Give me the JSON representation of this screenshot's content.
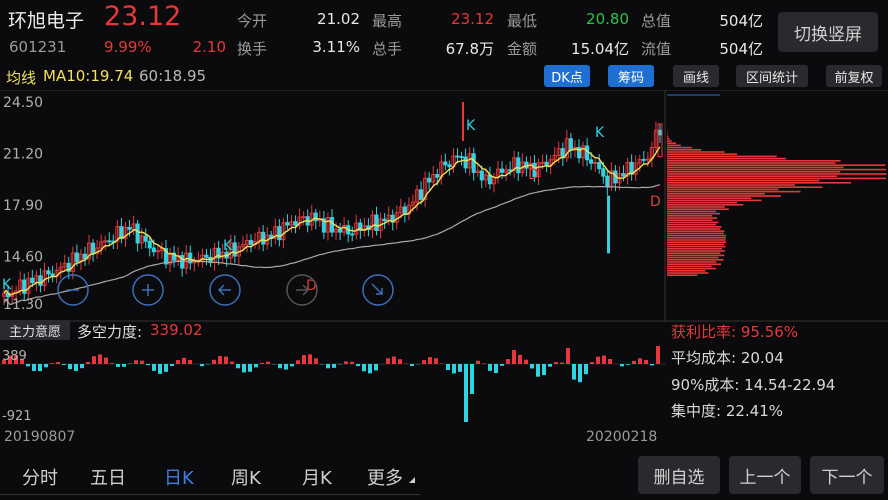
{
  "stock": {
    "name": "环旭电子",
    "code": "601231",
    "price": "23.12",
    "change_pct": "9.99%",
    "change": "2.10"
  },
  "quote": {
    "open_label": "今开",
    "open": "21.02",
    "high_label": "最高",
    "high": "23.12",
    "low_label": "最低",
    "low": "20.80",
    "mktcap_label": "总值",
    "mktcap": "504亿",
    "turnover_label": "换手",
    "turnover": "3.11%",
    "volume_label": "总手",
    "volume": "67.8万",
    "amount_label": "金额",
    "amount": "15.04亿",
    "float_label": "流值",
    "float": "504亿"
  },
  "switch_label": "切换竖屏",
  "indicator": {
    "label": "均线",
    "ma10": "MA10:19.74",
    "ma60": "60:18.95"
  },
  "toolbar": {
    "dk": "DK点",
    "chip": "筹码",
    "draw": "画线",
    "range": "区间统计",
    "fq": "前复权"
  },
  "price_axis": [
    "24.50",
    "21.20",
    "17.90",
    "14.60",
    "11.30"
  ],
  "marks": [
    "K",
    "K",
    "K",
    "K",
    "D",
    "D",
    "D"
  ],
  "lower_panel": {
    "button": "主力意愿",
    "title": "多空力度:",
    "value": "339.02",
    "axis_top": "389",
    "axis_bottom": "-921"
  },
  "chip_stats": {
    "profit_label": "获利比率:",
    "profit": "95.56%",
    "avg_cost": "平均成本: 20.04",
    "cost90": "90%成本: 14.54-22.94",
    "concentration": "集中度: 22.41%"
  },
  "dates": {
    "start": "20190807",
    "end": "20200218"
  },
  "tabs": [
    "分时",
    "五日",
    "日K",
    "周K",
    "月K",
    "更多"
  ],
  "active_tab": "日K",
  "footer_buttons": {
    "remove": "删自选",
    "prev": "上一个",
    "next": "下一个"
  },
  "colors": {
    "up": "#e8373a",
    "down": "#2fd4e0",
    "ma10": "#f0e05a",
    "ma60": "#b0b0b0",
    "accent": "#1f6fd1"
  }
}
